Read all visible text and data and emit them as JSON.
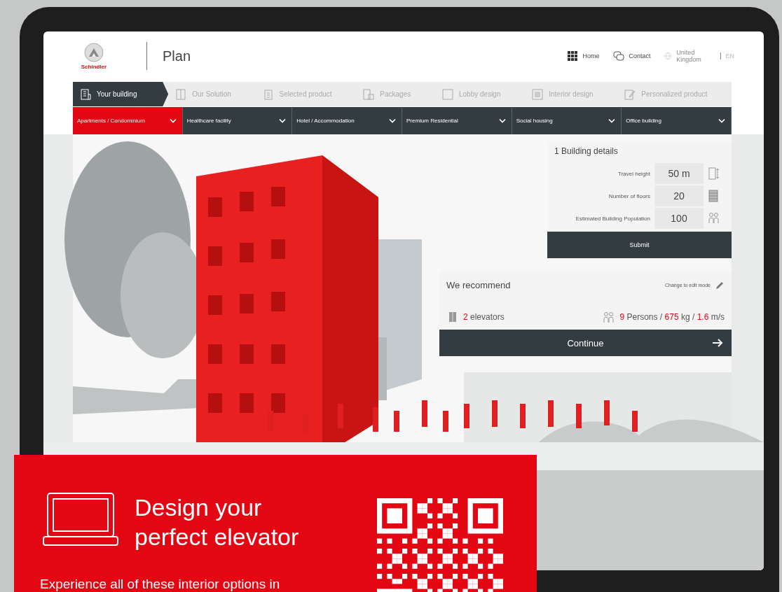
{
  "header": {
    "logo_text": "Schindler",
    "title": "Plan",
    "links": [
      {
        "label": "Home",
        "kind": "grid"
      },
      {
        "label": "Contact",
        "kind": "chat"
      },
      {
        "label": "United Kingdom",
        "kind": "globe"
      }
    ],
    "language": "EN"
  },
  "steps": [
    {
      "label": "Your building",
      "kind": "building",
      "selected": true
    },
    {
      "label": "Our Solution",
      "kind": "elevator",
      "selected": false
    },
    {
      "label": "Selected product",
      "kind": "clipboard",
      "selected": false
    },
    {
      "label": "Packages",
      "kind": "package",
      "selected": false
    },
    {
      "label": "Lobby design",
      "kind": "square",
      "selected": false
    },
    {
      "label": "Interior design",
      "kind": "interior",
      "selected": false
    },
    {
      "label": "Personalized product",
      "kind": "edit",
      "selected": false
    }
  ],
  "categories": [
    {
      "label": "Apartments / Condominium",
      "selected": true
    },
    {
      "label": "Healthcare facility",
      "selected": false
    },
    {
      "label": "Hotel / Accommodation",
      "selected": false
    },
    {
      "label": "Premium Residential",
      "selected": false
    },
    {
      "label": "Social housing",
      "selected": false
    },
    {
      "label": "Office building",
      "selected": false
    }
  ],
  "building_details": {
    "title": "1 Building details",
    "fields": [
      {
        "label": "Travel height",
        "value": "50 m",
        "kind": "height"
      },
      {
        "label": "Number of floors",
        "value": "20",
        "kind": "floors"
      },
      {
        "label": "Estimated Building Population",
        "value": "100",
        "kind": "people"
      }
    ],
    "submit": "Submit"
  },
  "recommendation": {
    "title": "We recommend",
    "edit_link": "Change to edit mode",
    "elevators_count": "2",
    "elevators_label": "elevators",
    "persons": "9",
    "persons_unit": "Persons /",
    "load": "675",
    "load_unit": "kg /",
    "speed": "1.6",
    "speed_unit": "m/s",
    "continue": "Continue"
  },
  "promo": {
    "title_lines": [
      "Design your",
      "perfect elevator"
    ],
    "text": "Experience all of these interior options in"
  }
}
